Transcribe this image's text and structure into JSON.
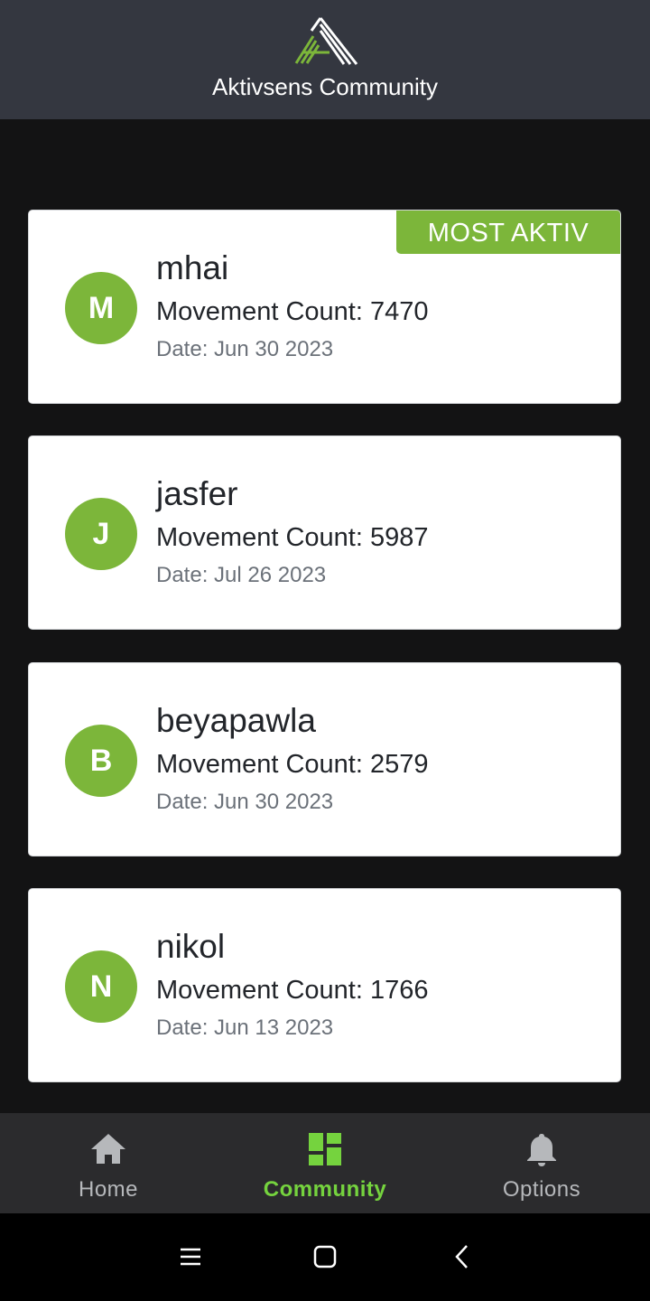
{
  "header": {
    "title": "Aktivsens Community",
    "logo_icon": "aktivsens-logo"
  },
  "leaderboard": [
    {
      "initial": "M",
      "username": "mhai",
      "movement_count": "Movement Count: 7470",
      "date": "Date: Jun 30 2023",
      "badge": "MOST AKTIV"
    },
    {
      "initial": "J",
      "username": "jasfer",
      "movement_count": "Movement Count: 5987",
      "date": "Date: Jul 26 2023"
    },
    {
      "initial": "B",
      "username": "beyapawla",
      "movement_count": "Movement Count: 2579",
      "date": "Date: Jun 30 2023"
    },
    {
      "initial": "N",
      "username": "nikol",
      "movement_count": "Movement Count: 1766",
      "date": "Date: Jun 13 2023"
    }
  ],
  "bottom_nav": {
    "items": [
      {
        "label": "Home",
        "icon": "home-icon",
        "active": false
      },
      {
        "label": "Community",
        "icon": "dashboard-icon",
        "active": true
      },
      {
        "label": "Options",
        "icon": "bell-icon",
        "active": false
      }
    ]
  },
  "system_nav": {
    "icons": [
      "menu-icon",
      "home-square-icon",
      "back-icon"
    ]
  },
  "colors": {
    "header_bg": "#343740",
    "page_bg": "#131314",
    "accent_green": "#7cb63a",
    "nav_active": "#75d33e",
    "nav_inactive": "#b6b8bb",
    "nav_bg": "#2b2b2d"
  }
}
